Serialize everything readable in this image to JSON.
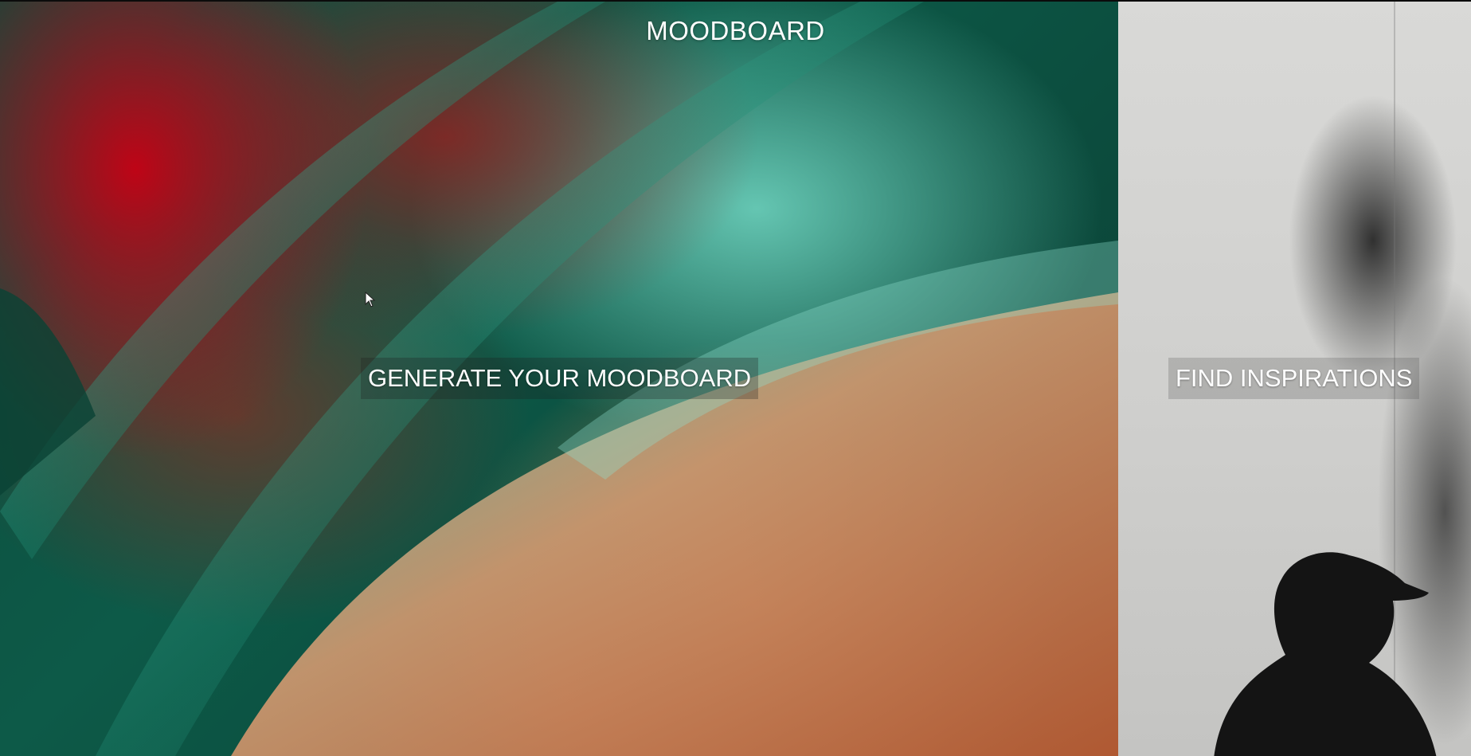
{
  "header": {
    "title": "MOODBOARD"
  },
  "left_panel": {
    "button_label": "GENERATE YOUR MOODBOARD"
  },
  "right_panel": {
    "button_label": "FIND INSPIRATIONS"
  },
  "colors": {
    "red": "#c8001a",
    "teal": "#6ed2be",
    "dark_green": "#0c4a3b",
    "peach": "#d28c5a",
    "concrete": "#d9d9d7"
  }
}
